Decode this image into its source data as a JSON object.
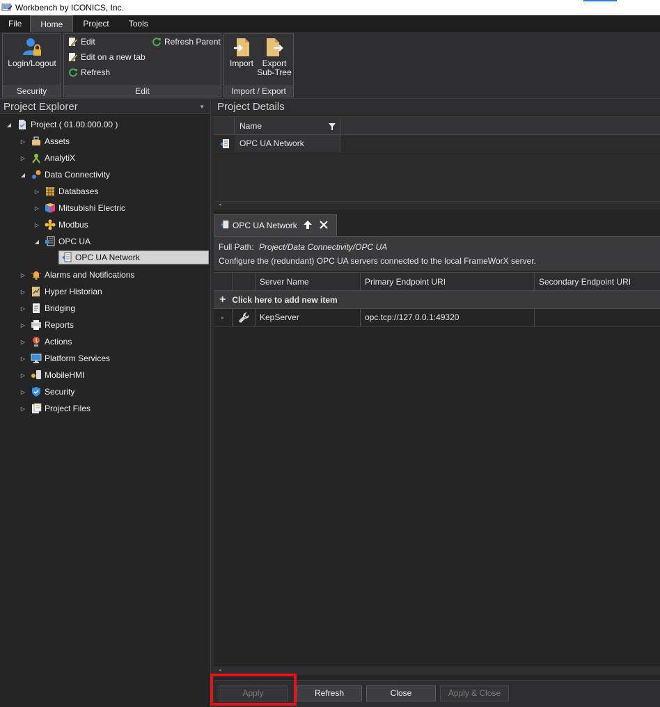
{
  "window": {
    "title": "Workbench by ICONICS, Inc."
  },
  "menu": {
    "tabs": [
      "File",
      "Home",
      "Project",
      "Tools"
    ],
    "active": "Home"
  },
  "ribbon": {
    "security": {
      "login_label": "Login/Logout",
      "group_label": "Security"
    },
    "edit": {
      "edit_label": "Edit",
      "edit_new_tab_label": "Edit on a new tab",
      "refresh_label": "Refresh",
      "refresh_parent_label": "Refresh Parent",
      "group_label": "Edit"
    },
    "import_export": {
      "import_label": "Import",
      "export_label_1": "Export",
      "export_label_2": "Sub-Tree",
      "group_label": "Import / Export"
    }
  },
  "explorer": {
    "title": "Project Explorer",
    "root": "Project ( 01.00.000.00 )",
    "items": {
      "assets": "Assets",
      "analytix": "AnalytiX",
      "data_connectivity": "Data Connectivity",
      "databases": "Databases",
      "mitsubishi": "Mitsubishi Electric",
      "modbus": "Modbus",
      "opc_ua": "OPC UA",
      "opc_ua_network": "OPC UA Network",
      "alarms": "Alarms and Notifications",
      "hyper_historian": "Hyper Historian",
      "bridging": "Bridging",
      "reports": "Reports",
      "actions": "Actions",
      "platform_services": "Platform Services",
      "mobilehmi": "MobileHMI",
      "security": "Security",
      "project_files": "Project Files"
    }
  },
  "details": {
    "title": "Project Details",
    "grid": {
      "name_header": "Name",
      "rows": [
        "OPC UA Network"
      ]
    },
    "tab": {
      "label": "OPC UA Network"
    },
    "info": {
      "full_path_label": "Full Path:",
      "full_path_value": "Project/Data Connectivity/OPC UA",
      "description": "Configure the (redundant) OPC UA servers connected to the local  FrameWorX server."
    },
    "servers": {
      "headers": {
        "server_name": "Server Name",
        "primary": "Primary Endpoint URI",
        "secondary": "Secondary Endpoint URI"
      },
      "add_new": "Click here to add new item",
      "rows": [
        {
          "server_name": "KepServer",
          "primary": "opc.tcp://127.0.0.1:49320",
          "secondary": ""
        }
      ]
    }
  },
  "footer": {
    "apply": "Apply",
    "refresh": "Refresh",
    "close": "Close",
    "apply_close": "Apply & Close"
  },
  "colors": {
    "highlight": "#e0161b",
    "background": "#252526",
    "ribbon": "#2d2d30"
  }
}
